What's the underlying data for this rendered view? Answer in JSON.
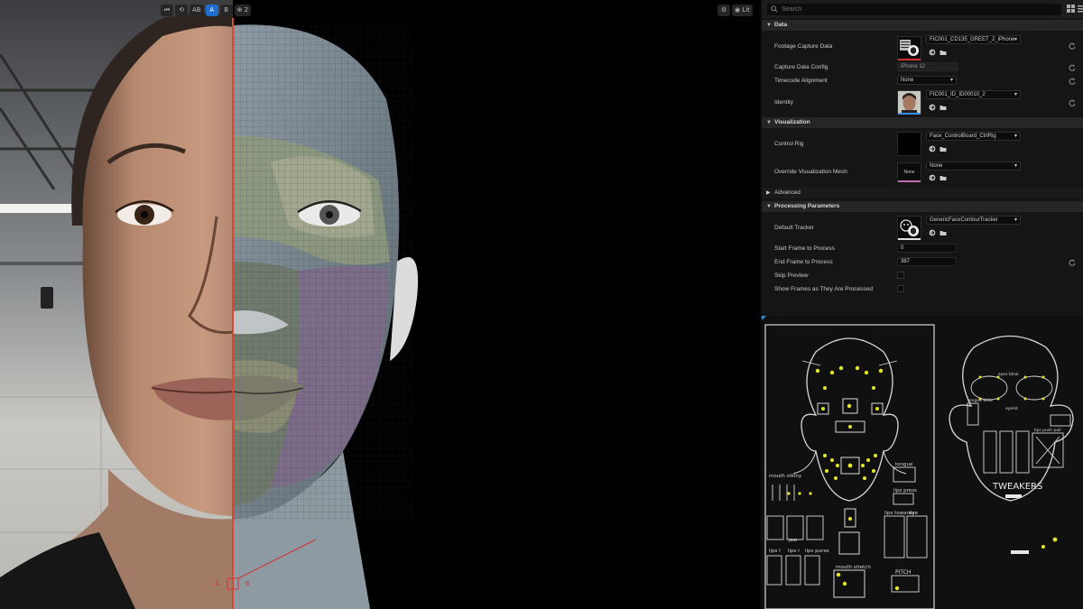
{
  "viewport": {
    "toolbar_left": [
      "⏮",
      "⟲",
      "AB",
      "A",
      "B",
      "⊕ 2"
    ],
    "toolbar_right": [
      "⚙",
      "◉ Lit"
    ],
    "ab_labels": {
      "a": "A",
      "b": "B"
    }
  },
  "details": {
    "search_placeholder": "Search",
    "categories": {
      "data": "Data",
      "visualization": "Visualization",
      "advanced": "Advanced",
      "processing": "Processing Parameters"
    },
    "props": {
      "footage_capture_data": {
        "label": "Footage Capture Data",
        "value": "FIC001_CD135_GREET_2_iPhone"
      },
      "capture_data_config": {
        "label": "Capture Data Config",
        "value": "iPhone 12"
      },
      "timecode_alignment": {
        "label": "Timecode Alignment",
        "value": "None"
      },
      "identity": {
        "label": "Identity",
        "value": "FIC001_ID_ID00010_2"
      },
      "control_rig": {
        "label": "Control Rig",
        "value": "Face_ControlBoard_CtrlRig"
      },
      "override_visualization_mesh": {
        "label": "Override Visualization Mesh",
        "thumb": "None",
        "value": "None"
      },
      "default_tracker": {
        "label": "Default Tracker",
        "value": "GenericFaceContourTracker"
      },
      "start_frame": {
        "label": "Start Frame to Process",
        "value": "0"
      },
      "end_frame": {
        "label": "End Frame to Process",
        "value": "387"
      },
      "skip_preview": {
        "label": "Skip Preview"
      },
      "show_frames": {
        "label": "Show Frames as They Are Processed"
      }
    },
    "colors": {
      "footage_underline": "#d33030",
      "identity_underline": "#3a8fd9",
      "tracker_underline": "#e0e0e0"
    }
  },
  "board": {
    "labels": {
      "mouth_stickiness": "mouth stkiny",
      "lips_l": "lips l",
      "lips_r": "lips r",
      "lips_purse": "lips purse",
      "mouth_stretch": "mouth stretch",
      "jaw": "jaw",
      "tongue": "tongue",
      "lips_press": "lips press",
      "lips_towards": "lips towards",
      "eye": "eye",
      "pitch": "PITCH",
      "tweakers": "TWEAKERS",
      "eyes_blink": "eyes blink",
      "tongue_wide": "tongue wide",
      "lips_push": "lips push pull",
      "eyelid": "eyelid"
    },
    "accent": "#e6e629"
  }
}
